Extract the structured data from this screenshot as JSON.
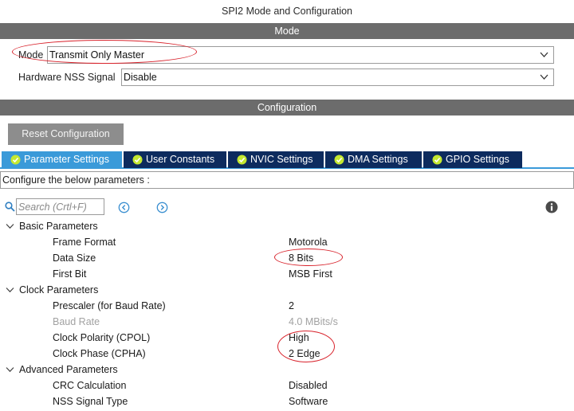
{
  "window": {
    "title": "SPI2 Mode and Configuration"
  },
  "mode_section": {
    "header": "Mode",
    "mode_label": "Mode",
    "mode_value": "Transmit Only Master",
    "nss_label": "Hardware NSS Signal",
    "nss_value": "Disable"
  },
  "config_section": {
    "header": "Configuration",
    "reset_label": "Reset Configuration",
    "tabs": [
      {
        "label": "Parameter Settings",
        "active": true
      },
      {
        "label": "User Constants",
        "active": false
      },
      {
        "label": "NVIC Settings",
        "active": false
      },
      {
        "label": "DMA Settings",
        "active": false
      },
      {
        "label": "GPIO Settings",
        "active": false
      }
    ],
    "hint": "Configure the below parameters :",
    "search_placeholder": "Search (Crtl+F)"
  },
  "tree": {
    "basic": {
      "label": "Basic Parameters",
      "rows": [
        {
          "name": "Frame Format",
          "value": "Motorola"
        },
        {
          "name": "Data Size",
          "value": "8 Bits"
        },
        {
          "name": "First Bit",
          "value": "MSB First"
        }
      ]
    },
    "clock": {
      "label": "Clock Parameters",
      "rows": [
        {
          "name": "Prescaler (for Baud Rate)",
          "value": "2"
        },
        {
          "name": "Baud Rate",
          "value": "4.0 MBits/s"
        },
        {
          "name": "Clock Polarity (CPOL)",
          "value": "High"
        },
        {
          "name": "Clock Phase (CPHA)",
          "value": "2 Edge"
        }
      ]
    },
    "advanced": {
      "label": "Advanced Parameters",
      "rows": [
        {
          "name": "CRC Calculation",
          "value": "Disabled"
        },
        {
          "name": "NSS Signal Type",
          "value": "Software"
        }
      ]
    }
  },
  "colors": {
    "section_bar": "#6c6c6c",
    "tab_active": "#3a9ad9",
    "tab_inactive": "#0d2b5e",
    "check_icon": "#c4e830",
    "annotation_oval": "#d8222b",
    "disabled_text": "#a2a2a2"
  },
  "icons": {
    "search": "search-icon",
    "prev": "circle-chevron-left-icon",
    "next": "circle-chevron-right-icon",
    "info": "info-icon",
    "tab_check": "check-circle-icon",
    "expand": "chevron-down-icon",
    "dropdown": "chevron-down-icon"
  }
}
